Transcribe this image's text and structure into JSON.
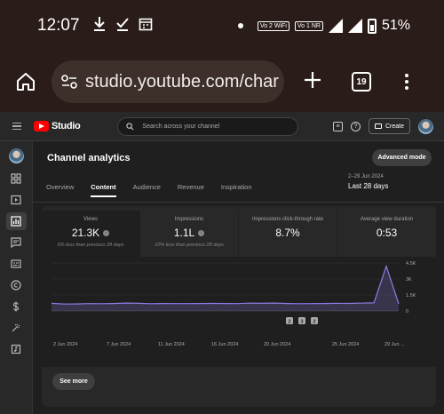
{
  "status_bar": {
    "time": "12:07",
    "battery": "51%",
    "sim1": "Vo 2 WiFi",
    "sim2": "Vo 1 NR"
  },
  "browser": {
    "url": "studio.youtube.com/char",
    "tab_count": "19"
  },
  "header": {
    "logo_text": "Studio",
    "search_placeholder": "Search across your channel",
    "create_label": "Create"
  },
  "page": {
    "title": "Channel analytics",
    "advanced_mode_label": "Advanced mode",
    "tabs": [
      {
        "label": "Overview"
      },
      {
        "label": "Content",
        "active": true
      },
      {
        "label": "Audience"
      },
      {
        "label": "Revenue"
      },
      {
        "label": "Inspiration"
      }
    ],
    "date_range_sub": "2–29 Jun 2024",
    "date_range": "Last 28 days",
    "see_more_label": "See more"
  },
  "metrics": [
    {
      "label": "Views",
      "value": "21.3K",
      "note": "6% less than previous 28 days"
    },
    {
      "label": "Impressions",
      "value": "1.1L",
      "note": "10% less than previous 28 days"
    },
    {
      "label": "Impressions click-through rate",
      "value": "8.7%",
      "note": ""
    },
    {
      "label": "Average view duration",
      "value": "0:53",
      "note": ""
    }
  ],
  "chart_data": {
    "type": "area",
    "y_ticks": [
      "4.5K",
      "3K",
      "1.5K",
      "0"
    ],
    "x_ticks": [
      "2 Jun 2024",
      "7 Jun 2024",
      "11 Jun 2024",
      "16 Jun 2024",
      "20 Jun 2024",
      "25 Jun 2024",
      "29 Jun ..."
    ],
    "markers": [
      "2",
      "3",
      "2"
    ],
    "ylim": [
      0,
      4500
    ],
    "series": [
      {
        "color": "#8c7fe8",
        "values": [
          720,
          650,
          660,
          690,
          680,
          700,
          740,
          720,
          680,
          700,
          690,
          690,
          700,
          710,
          700,
          690,
          730,
          720,
          740,
          700,
          680,
          690,
          700,
          720,
          710,
          730,
          760,
          4200,
          660
        ]
      }
    ]
  },
  "colors": {
    "accent": "#ff0000",
    "line": "#8c7fe8"
  }
}
